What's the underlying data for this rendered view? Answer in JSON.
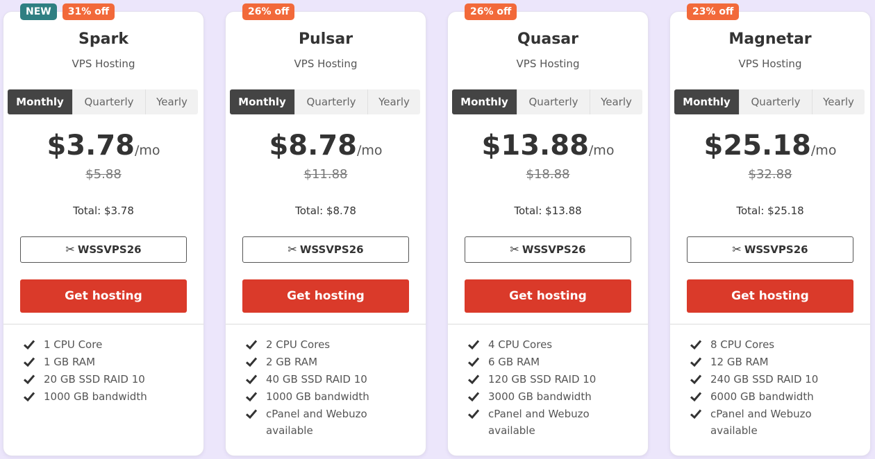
{
  "billing_options": [
    "Monthly",
    "Quarterly",
    "Yearly"
  ],
  "cta_label": "Get hosting",
  "coupon_code": "WSSVPS26",
  "plans": [
    {
      "badges": [
        "NEW",
        "31% off"
      ],
      "name": "Spark",
      "type": "VPS Hosting",
      "price": "$3.78",
      "per": "/mo",
      "old_price": "$5.88",
      "total": "Total: $3.78",
      "features": [
        "1 CPU Core",
        "1 GB RAM",
        "20 GB SSD RAID 10",
        "1000 GB bandwidth"
      ]
    },
    {
      "badges": [
        "26% off"
      ],
      "name": "Pulsar",
      "type": "VPS Hosting",
      "price": "$8.78",
      "per": "/mo",
      "old_price": "$11.88",
      "total": "Total: $8.78",
      "features": [
        "2 CPU Cores",
        "2 GB RAM",
        "40 GB SSD RAID 10",
        "1000 GB bandwidth",
        "cPanel and Webuzo available"
      ]
    },
    {
      "badges": [
        "26% off"
      ],
      "name": "Quasar",
      "type": "VPS Hosting",
      "price": "$13.88",
      "per": "/mo",
      "old_price": "$18.88",
      "total": "Total: $13.88",
      "features": [
        "4 CPU Cores",
        "6 GB RAM",
        "120 GB SSD RAID 10",
        "3000 GB bandwidth",
        "cPanel and Webuzo available"
      ]
    },
    {
      "badges": [
        "23% off"
      ],
      "name": "Magnetar",
      "type": "VPS Hosting",
      "price": "$25.18",
      "per": "/mo",
      "old_price": "$32.88",
      "total": "Total: $25.18",
      "features": [
        "8 CPU Cores",
        "12 GB RAM",
        "240 GB SSD RAID 10",
        "6000 GB bandwidth",
        "cPanel and Webuzo available"
      ]
    }
  ],
  "colors": {
    "cta": "#da3a2a",
    "badge_new": "#2f7f82",
    "badge_off": "#f2693a",
    "active_tab": "#444444"
  }
}
